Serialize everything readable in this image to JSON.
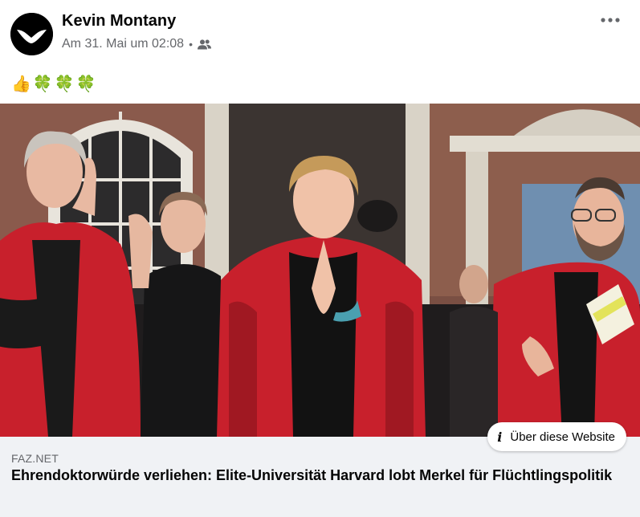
{
  "post": {
    "author": "Kevin Montany",
    "timestamp": "Am 31. Mai um 02:08",
    "separator": "•",
    "audience_icon": "friends-icon",
    "more_icon": "more-horizontal-icon",
    "text_emojis": [
      "👍",
      "🍀",
      "🍀",
      "🍀"
    ]
  },
  "link_preview": {
    "domain": "FAZ.NET",
    "headline": "Ehrendoktorwürde verliehen: Elite-Universität Harvard lobt Merkel für Flüchtlingspolitik",
    "about_button": "Über diese Website",
    "about_icon": "info-icon"
  },
  "colors": {
    "text_primary": "#050505",
    "text_secondary": "#65676b",
    "preview_background": "#f0f2f5",
    "gown_red": "#c8202c"
  }
}
